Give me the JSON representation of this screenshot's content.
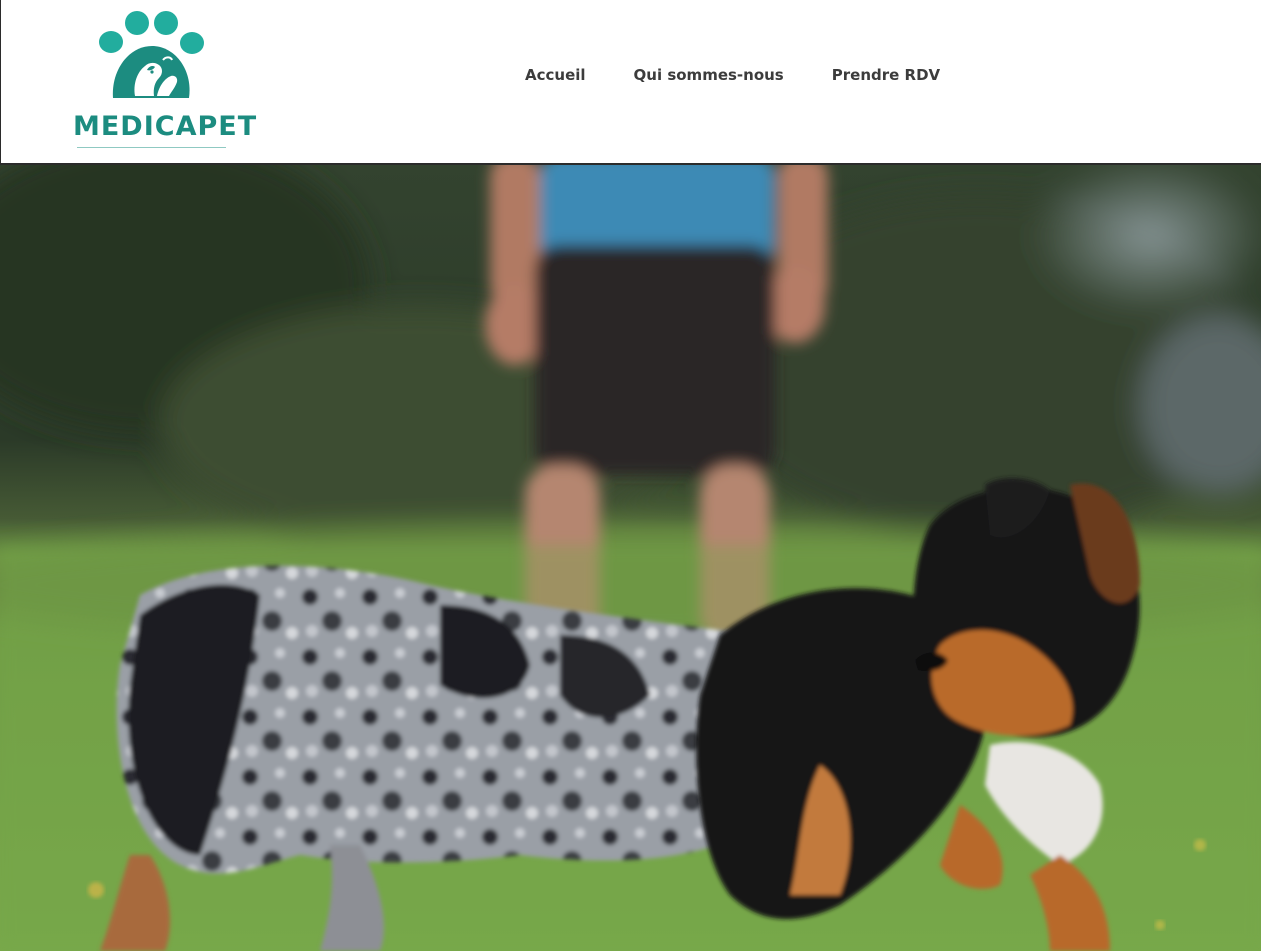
{
  "brand": {
    "name": "MEDICAPET",
    "primary_color": "#1c8c80",
    "accent_color": "#22ad9e",
    "logo_icon": "paw-icon"
  },
  "nav": {
    "items": [
      {
        "label": "Accueil"
      },
      {
        "label": "Qui sommes-nous"
      },
      {
        "label": "Prendre RDV"
      }
    ]
  },
  "hero": {
    "image": "two-puppies-playing-on-grass-photo"
  }
}
